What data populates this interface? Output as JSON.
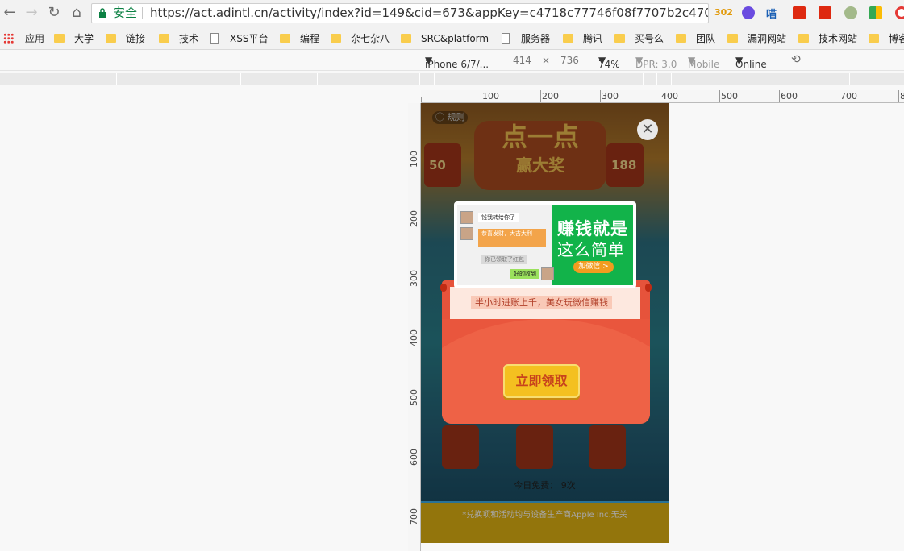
{
  "browser": {
    "secure_label": "安全",
    "url": "https://act.adintl.cn/activity/index?id=149&cid=673&appKey=c4718c77746f08f7707b2c4703017548...",
    "ext_badge": "302",
    "ext_label_2": "喵"
  },
  "bookmarks": {
    "items": [
      "应用",
      "大学",
      "链接",
      "技术",
      "XSS平台",
      "编程",
      "杂七杂八",
      "SRC&platform",
      "服务器",
      "腾讯",
      "买号么",
      "团队",
      "漏洞网站",
      "技术网站",
      "博客"
    ]
  },
  "device_toolbar": {
    "device": "iPhone 6/7/...",
    "width": "414",
    "times": "×",
    "height": "736",
    "zoom": "74%",
    "dpr": "DPR: 3.0",
    "mode": "Mobile",
    "network": "Online"
  },
  "ruler": {
    "h_labels": [
      "100",
      "200",
      "300",
      "400",
      "500",
      "600",
      "700",
      "8"
    ],
    "v_labels": [
      "100",
      "200",
      "300",
      "400",
      "500",
      "600",
      "700"
    ]
  },
  "game": {
    "rules_label": "规则",
    "title_line1": "点一点",
    "title_line2": "赢大奖",
    "can_left_num": "50",
    "can_right_num": "188",
    "close_glyph": "✕",
    "free_today": "今日免费： 9次",
    "footer_note": "*兑换项和活动均与设备生产商Apple Inc.无关"
  },
  "popup": {
    "chat_bubble_1": "钱我转给你了",
    "chat_bubble_2": "恭喜发财，大吉大利",
    "chat_bubble_3": "你已领取了红包",
    "chat_bubble_4": "好的收到",
    "banner_title": "赚钱就是",
    "banner_sub": "这么简单",
    "wechat_button": "加微信 >",
    "slogan": "半小时进账上千，美女玩微信赚钱",
    "claim_button": "立即领取"
  },
  "colors": {
    "banner_green": "#12b34a",
    "envelope_red": "#e6533b",
    "claim_gold": "#f4c020",
    "footer_gold": "#e2b413"
  }
}
